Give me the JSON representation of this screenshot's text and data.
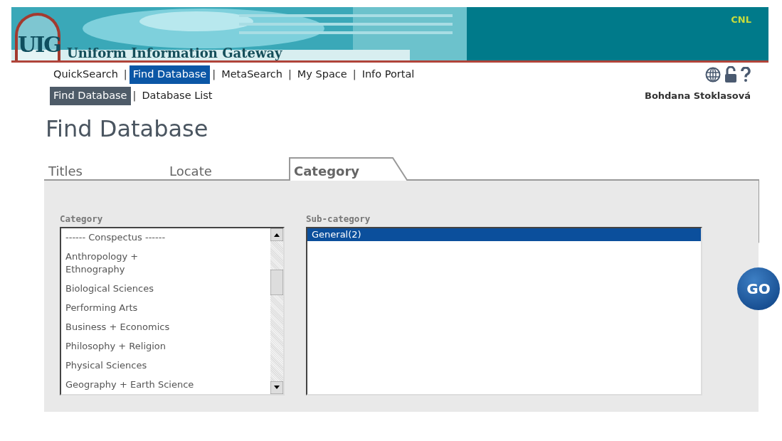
{
  "banner": {
    "logo": "UIG",
    "title": "Uniform Information Gateway",
    "org": "CNL"
  },
  "nav": {
    "separator": "|",
    "items": [
      {
        "label": "QuickSearch",
        "selected": false
      },
      {
        "label": "Find Database",
        "selected": true
      },
      {
        "label": "MetaSearch",
        "selected": false
      },
      {
        "label": "My Space",
        "selected": false
      },
      {
        "label": "Info Portal",
        "selected": false
      }
    ]
  },
  "subnav": {
    "separator": "|",
    "items": [
      {
        "label": "Find Database",
        "selected": true
      },
      {
        "label": "Database List",
        "selected": false
      }
    ]
  },
  "user": "Bohdana Stoklasová",
  "page_title": "Find Database",
  "tabs": [
    {
      "label": "Titles",
      "selected": false
    },
    {
      "label": "Locate",
      "selected": false
    },
    {
      "label": "Category",
      "selected": true
    }
  ],
  "category": {
    "label": "Category",
    "items": [
      {
        "label": "------ Conspectus ------",
        "selected": false
      },
      {
        "label": "Anthropology + Ethnography",
        "selected": false
      },
      {
        "label": "Biological Sciences",
        "selected": false
      },
      {
        "label": "Performing Arts",
        "selected": false
      },
      {
        "label": "Business + Economics",
        "selected": false
      },
      {
        "label": "Philosophy + Religion",
        "selected": false
      },
      {
        "label": "Physical Sciences",
        "selected": false
      },
      {
        "label": "Geography + Earth Science",
        "selected": false
      }
    ]
  },
  "subcategory": {
    "label": "Sub-category",
    "items": [
      {
        "label": "General(2)",
        "selected": true
      }
    ]
  },
  "go_button": "GO"
}
